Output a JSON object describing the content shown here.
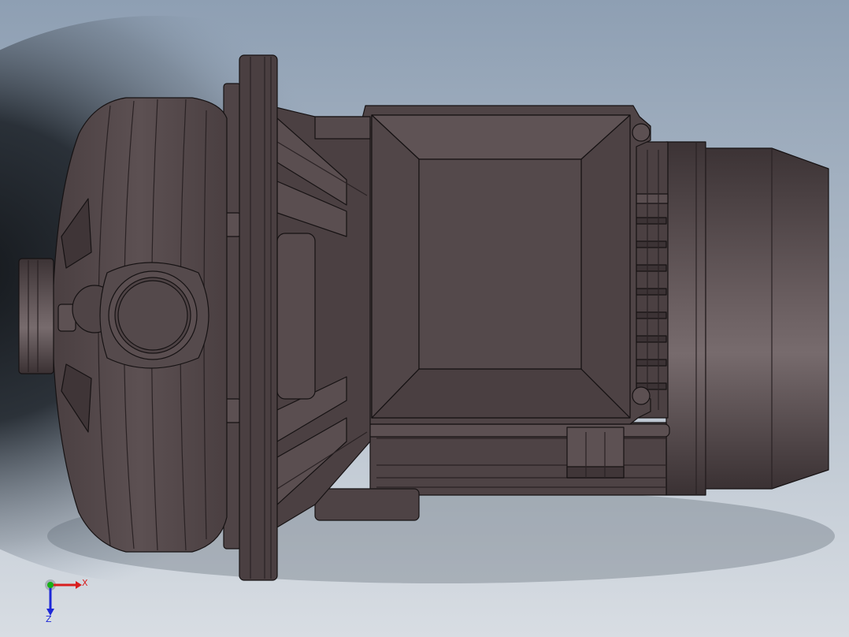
{
  "scene": {
    "background_top": "#8e9fb3",
    "background_bottom": "#d3d9e0",
    "shadow_color": "#1e2227",
    "model_body_color": "#54484a",
    "model_dark_color": "#3e3436",
    "model_edge_color": "#161213"
  },
  "triad": {
    "x_label": "X",
    "y_label": "",
    "z_label": "Z",
    "x_color": "#d81e1e",
    "y_color": "#18b018",
    "z_color": "#1e28d8"
  }
}
